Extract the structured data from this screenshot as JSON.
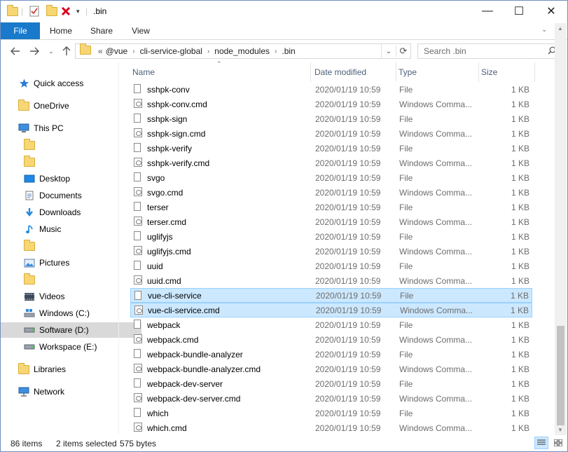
{
  "window": {
    "title": ".bin",
    "minimize": "—",
    "maximize": "☐",
    "close": "✕"
  },
  "ribbon": {
    "tabs": [
      "File",
      "Home",
      "Share",
      "View"
    ]
  },
  "address": {
    "overflow": "«",
    "crumbs": [
      "@vue",
      "cli-service-global",
      "node_modules",
      ".bin"
    ]
  },
  "search": {
    "placeholder": "Search .bin"
  },
  "nav": [
    {
      "label": "Quick access",
      "icon": "star-icon"
    },
    {
      "label": "OneDrive",
      "icon": "folder-icon"
    },
    {
      "label": "This PC",
      "icon": "pc-icon"
    },
    {
      "label": "",
      "icon": "folder-icon"
    },
    {
      "label": "",
      "icon": "folder-icon"
    },
    {
      "label": "Desktop",
      "icon": "desktop-icon"
    },
    {
      "label": "Documents",
      "icon": "documents-icon"
    },
    {
      "label": "Downloads",
      "icon": "download-icon"
    },
    {
      "label": "Music",
      "icon": "music-icon"
    },
    {
      "label": "",
      "icon": "folder-icon"
    },
    {
      "label": "Pictures",
      "icon": "pictures-icon"
    },
    {
      "label": "",
      "icon": "folder-icon"
    },
    {
      "label": "Videos",
      "icon": "videos-icon"
    },
    {
      "label": "Windows (C:)",
      "icon": "drive-icon"
    },
    {
      "label": "Software (D:)",
      "icon": "drive-icon"
    },
    {
      "label": "Workspace (E:)",
      "icon": "drive-icon"
    },
    {
      "label": "Libraries",
      "icon": "libraries-icon"
    },
    {
      "label": "Network",
      "icon": "network-icon"
    }
  ],
  "columns": {
    "name": "Name",
    "date": "Date modified",
    "type": "Type",
    "size": "Size"
  },
  "files": [
    {
      "name": "sshpk-conv",
      "date": "2020/01/19 10:59",
      "type": "File",
      "size": "1 KB"
    },
    {
      "name": "sshpk-conv.cmd",
      "date": "2020/01/19 10:59",
      "type": "Windows Comma...",
      "size": "1 KB"
    },
    {
      "name": "sshpk-sign",
      "date": "2020/01/19 10:59",
      "type": "File",
      "size": "1 KB"
    },
    {
      "name": "sshpk-sign.cmd",
      "date": "2020/01/19 10:59",
      "type": "Windows Comma...",
      "size": "1 KB"
    },
    {
      "name": "sshpk-verify",
      "date": "2020/01/19 10:59",
      "type": "File",
      "size": "1 KB"
    },
    {
      "name": "sshpk-verify.cmd",
      "date": "2020/01/19 10:59",
      "type": "Windows Comma...",
      "size": "1 KB"
    },
    {
      "name": "svgo",
      "date": "2020/01/19 10:59",
      "type": "File",
      "size": "1 KB"
    },
    {
      "name": "svgo.cmd",
      "date": "2020/01/19 10:59",
      "type": "Windows Comma...",
      "size": "1 KB"
    },
    {
      "name": "terser",
      "date": "2020/01/19 10:59",
      "type": "File",
      "size": "1 KB"
    },
    {
      "name": "terser.cmd",
      "date": "2020/01/19 10:59",
      "type": "Windows Comma...",
      "size": "1 KB"
    },
    {
      "name": "uglifyjs",
      "date": "2020/01/19 10:59",
      "type": "File",
      "size": "1 KB"
    },
    {
      "name": "uglifyjs.cmd",
      "date": "2020/01/19 10:59",
      "type": "Windows Comma...",
      "size": "1 KB"
    },
    {
      "name": "uuid",
      "date": "2020/01/19 10:59",
      "type": "File",
      "size": "1 KB"
    },
    {
      "name": "uuid.cmd",
      "date": "2020/01/19 10:59",
      "type": "Windows Comma...",
      "size": "1 KB"
    },
    {
      "name": "vue-cli-service",
      "date": "2020/01/19 10:59",
      "type": "File",
      "size": "1 KB",
      "selected": true
    },
    {
      "name": "vue-cli-service.cmd",
      "date": "2020/01/19 10:59",
      "type": "Windows Comma...",
      "size": "1 KB",
      "selected": true
    },
    {
      "name": "webpack",
      "date": "2020/01/19 10:59",
      "type": "File",
      "size": "1 KB"
    },
    {
      "name": "webpack.cmd",
      "date": "2020/01/19 10:59",
      "type": "Windows Comma...",
      "size": "1 KB"
    },
    {
      "name": "webpack-bundle-analyzer",
      "date": "2020/01/19 10:59",
      "type": "File",
      "size": "1 KB"
    },
    {
      "name": "webpack-bundle-analyzer.cmd",
      "date": "2020/01/19 10:59",
      "type": "Windows Comma...",
      "size": "1 KB"
    },
    {
      "name": "webpack-dev-server",
      "date": "2020/01/19 10:59",
      "type": "File",
      "size": "1 KB"
    },
    {
      "name": "webpack-dev-server.cmd",
      "date": "2020/01/19 10:59",
      "type": "Windows Comma...",
      "size": "1 KB"
    },
    {
      "name": "which",
      "date": "2020/01/19 10:59",
      "type": "File",
      "size": "1 KB"
    },
    {
      "name": "which.cmd",
      "date": "2020/01/19 10:59",
      "type": "Windows Comma...",
      "size": "1 KB"
    }
  ],
  "status": {
    "items": "86 items",
    "selected": "2 items selected",
    "size": "575 bytes"
  },
  "colors": {
    "accent": "#1979ca",
    "selection_bg": "#cce8ff",
    "selection_border": "#99d1ff"
  }
}
